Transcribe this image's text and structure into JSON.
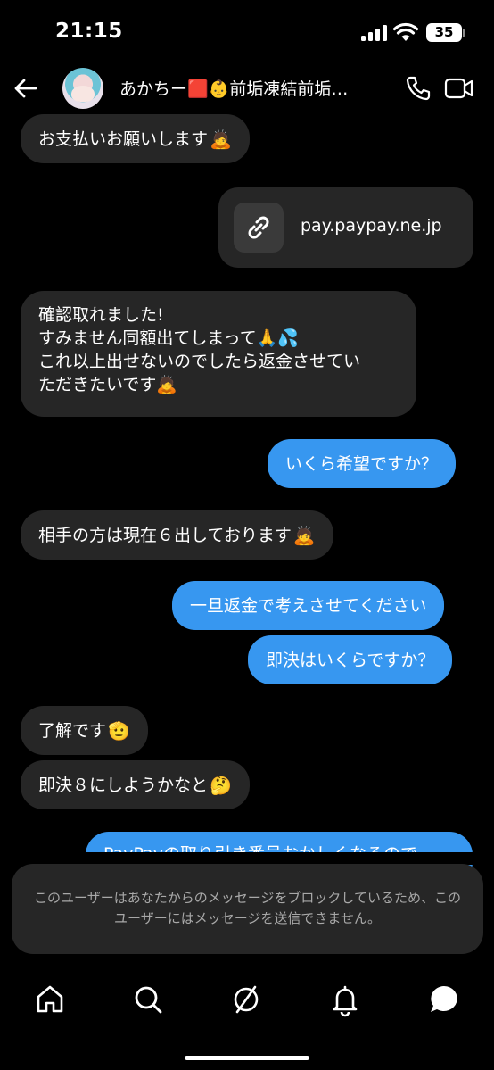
{
  "status_bar": {
    "time": "21:15",
    "battery": "35"
  },
  "header": {
    "title": "あかちー🟥👶前垢凍結前垢…",
    "icons": [
      "back-arrow-icon",
      "phone-icon",
      "video-icon"
    ]
  },
  "messages": [
    {
      "side": "in",
      "text": "お支払いお願いします",
      "emoji": "🙇"
    },
    {
      "side": "out",
      "type": "link",
      "text": "pay.paypay.ne.jp"
    },
    {
      "side": "in",
      "lines": [
        "確認取れました!",
        "すみません同額出てしまって🙏💦",
        "これ以上出せないのでしたら返金させてい",
        "ただきたいです🙇"
      ]
    },
    {
      "side": "out",
      "text": "いくら希望ですか？"
    },
    {
      "side": "in",
      "text": "相手の方は現在６出しております",
      "emoji": "🙇"
    },
    {
      "side": "out",
      "text": "一旦返金で考えさせてください"
    },
    {
      "side": "out",
      "text": "即決はいくらですか？"
    },
    {
      "side": "in",
      "text": "了解です",
      "emoji": "🫡"
    },
    {
      "side": "in",
      "text": "即決８にしようかなと",
      "emoji": "🤔"
    },
    {
      "side": "out",
      "text": "PayPayの取り引き番号おかしくなるので"
    }
  ],
  "blocked_notice": "このユーザーはあなたからのメッセージをブロックしているため、このユーザーにはメッセージを送信できません。",
  "bottom_nav": [
    "home-icon",
    "search-icon",
    "explore-icon",
    "notifications-icon",
    "messages-icon"
  ]
}
